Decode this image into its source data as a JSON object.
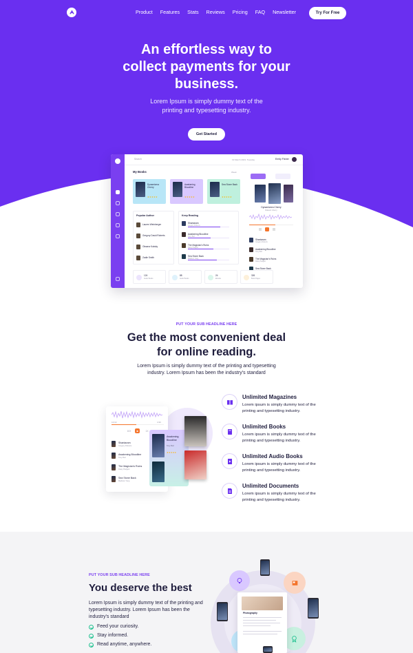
{
  "nav": {
    "links": [
      "Product",
      "Features",
      "Stats",
      "Reviews",
      "Pricing",
      "FAQ",
      "Newsletter"
    ],
    "cta": "Try For Free"
  },
  "hero": {
    "title_line1": "An effortless way to",
    "title_line2": "collect payments for your",
    "title_line3": "business.",
    "subtitle_line1": "Lorem Ipsum is simply dummy text of the",
    "subtitle_line2": "printing and typesetting industry.",
    "cta": "Get Started"
  },
  "dashboard": {
    "search": "Search",
    "date": "19 March 2023, Tuesday",
    "user": "Emily Fisher",
    "my_books": "My Books",
    "filter": "Week",
    "books": [
      {
        "title": "Dynamizera Cherry",
        "sub": "Rakesh Cherry"
      },
      {
        "title": "Awakening Bloodline",
        "sub": "Tony Burt"
      },
      {
        "title": "Sea Stone Back",
        "sub": "Ann Kim"
      }
    ],
    "popular_title": "Popular Author",
    "authors": [
      "Lauren Weinberger",
      "Gregory David Roberts",
      "Oksana Kuksky",
      "Zadie Smith"
    ],
    "reading_title": "Keep Reading",
    "reading": [
      {
        "title": "Shantaram",
        "sub": "Gregory Roberts",
        "pct": 0.78
      },
      {
        "title": "Awakening Bloodline",
        "sub": "Tony Burt",
        "pct": 0.55
      },
      {
        "title": "The Magician's Ruins",
        "sub": "Daisy Padgett",
        "pct": 0.62
      },
      {
        "title": "Sea Stone Back",
        "sub": "Madison Yang",
        "pct": 0.7
      }
    ],
    "now_playing": {
      "title": "Dynamizera Cherry",
      "sub": "Rakesh Cherry"
    },
    "queue": [
      {
        "title": "Shantaram",
        "sub": "Gregory Roberts"
      },
      {
        "title": "Awakening Bloodline",
        "sub": "Tony Burt"
      },
      {
        "title": "The Magician's Ruins",
        "sub": "Daisy Padgett"
      },
      {
        "title": "Sea Stone Back",
        "sub": "Madison Yang"
      }
    ],
    "stats": [
      {
        "value": "124",
        "label": "Audio Books",
        "color": "#7a3ff0"
      },
      {
        "value": "88",
        "label": "Audio Books",
        "color": "#3ab8f2"
      },
      {
        "value": "24",
        "label": "Ebooks",
        "color": "#20c190"
      },
      {
        "value": "326",
        "label": "Book Pages",
        "color": "#f5a623"
      }
    ]
  },
  "section2": {
    "eyebrow": "PUT YOUR SUB HEADLINE HERE",
    "title_line1": "Get the most convenient deal",
    "title_line2": "for online reading.",
    "desc_line1": "Lorem Ipsum is simply dummy text of the printing and typesetting",
    "desc_line2": "industry. Lorem Ipsum has been the industry's standard",
    "features": [
      {
        "title": "Unlimited Magazines",
        "desc": "Lorem ipsum is simply dummy text of the printing and typesetting industry.",
        "icon": "magazine-icon"
      },
      {
        "title": "Unlimited Books",
        "desc": "Lorem ipsum is simply dummy text of the printing and typesetting industry.",
        "icon": "book-icon"
      },
      {
        "title": "Unlimited Audio Books",
        "desc": "Lorem ipsum is simply dummy text of the printing and typesetting industry.",
        "icon": "audio-book-icon"
      },
      {
        "title": "Unlimited Documents",
        "desc": "Lorem ipsum is simply dummy text of the printing and typesetting industry.",
        "icon": "document-icon"
      }
    ],
    "player": {
      "time_left": "13:02",
      "time_right": "4:30",
      "speed_left": "10X",
      "speed_right": "1X",
      "queue": [
        {
          "title": "Shantaram",
          "sub": "Gregory Roberts"
        },
        {
          "title": "Awakening Bloodline",
          "sub": "Tony Burt"
        },
        {
          "title": "The Magician's Ruins",
          "sub": "Daisy Padgett"
        },
        {
          "title": "Sea Stone Back",
          "sub": "Madison Yang"
        }
      ]
    },
    "book_card": {
      "title": "Awakening Bloodline",
      "sub": "Tony Burt"
    }
  },
  "section3": {
    "eyebrow": "PUT YOUR SUB HEADLINE HERE",
    "title": "You deserve the best",
    "desc": "Lorem Ipsum is simply dummy text of the printing and typesetting industry. Lorem Ipsum has been the industry's standard",
    "checks": [
      "Feed your curiosity.",
      "Stay informed.",
      "Read anytime, anywhere."
    ],
    "doc_heading": "Photography"
  },
  "colors": {
    "brand": "#6a2ff0",
    "accent": "#7a3ff0",
    "check": "#20c190"
  }
}
